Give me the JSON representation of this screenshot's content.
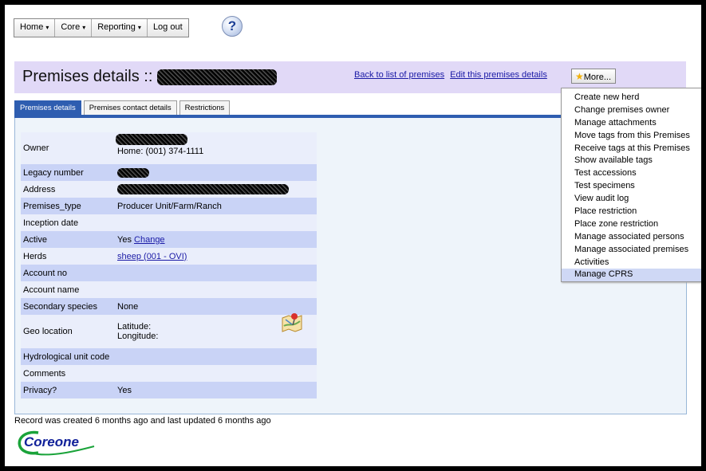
{
  "nav": {
    "items": [
      {
        "label": "Home",
        "caret": "▾"
      },
      {
        "label": "Core",
        "caret": "▾"
      },
      {
        "label": "Reporting",
        "caret": "▾"
      },
      {
        "label": "Log out",
        "caret": ""
      }
    ],
    "help_icon": "help-icon"
  },
  "header": {
    "title": "Premises details ::",
    "back_link": "Back to list of premises",
    "edit_link": "Edit this premises details",
    "more_button": "More..."
  },
  "tabs": [
    {
      "label": "Premises details",
      "active": true
    },
    {
      "label": "Premises contact details",
      "active": false
    },
    {
      "label": "Restrictions",
      "active": false
    }
  ],
  "details": {
    "owner_label": "Owner",
    "owner_phone": "Home: (001) 374-1111",
    "legacy_label": "Legacy number",
    "address_label": "Address",
    "type_label": "Premises_type",
    "type_value": "Producer Unit/Farm/Ranch",
    "inception_label": "Inception date",
    "active_label": "Active",
    "active_value": "Yes",
    "active_link": "Change",
    "herds_label": "Herds",
    "herds_link": "sheep (001 - OVI)",
    "account_no_label": "Account no",
    "account_name_label": "Account name",
    "secondary_label": "Secondary species",
    "secondary_value": "None",
    "geo_label": "Geo location",
    "latitude_label": "Latitude:",
    "longitude_label": "Longitude:",
    "huc_label": "Hydrological unit code",
    "comments_label": "Comments",
    "privacy_label": "Privacy?",
    "privacy_value": "Yes"
  },
  "more_menu": [
    "Create new herd",
    "Change premises owner",
    "Manage attachments",
    "Move tags from this Premises",
    "Receive tags at this Premises",
    "Show available tags",
    "Test accessions",
    "Test specimens",
    "View audit log",
    "Place restriction",
    "Place zone restriction",
    "Manage associated persons",
    "Manage associated premises",
    "Activities",
    "Manage CPRS"
  ],
  "highlighted_menu_item": "Manage CPRS",
  "footer": {
    "record_text": "Record was created 6 months ago and last updated 6 months ago",
    "logo_text": "Coreone"
  },
  "colors": {
    "header_bg": "#e1d9f7",
    "tab_active": "#2e5db0",
    "row_alt": "#c9d3f6",
    "link": "#1a1aa6",
    "logo_green": "#1aa33a"
  }
}
